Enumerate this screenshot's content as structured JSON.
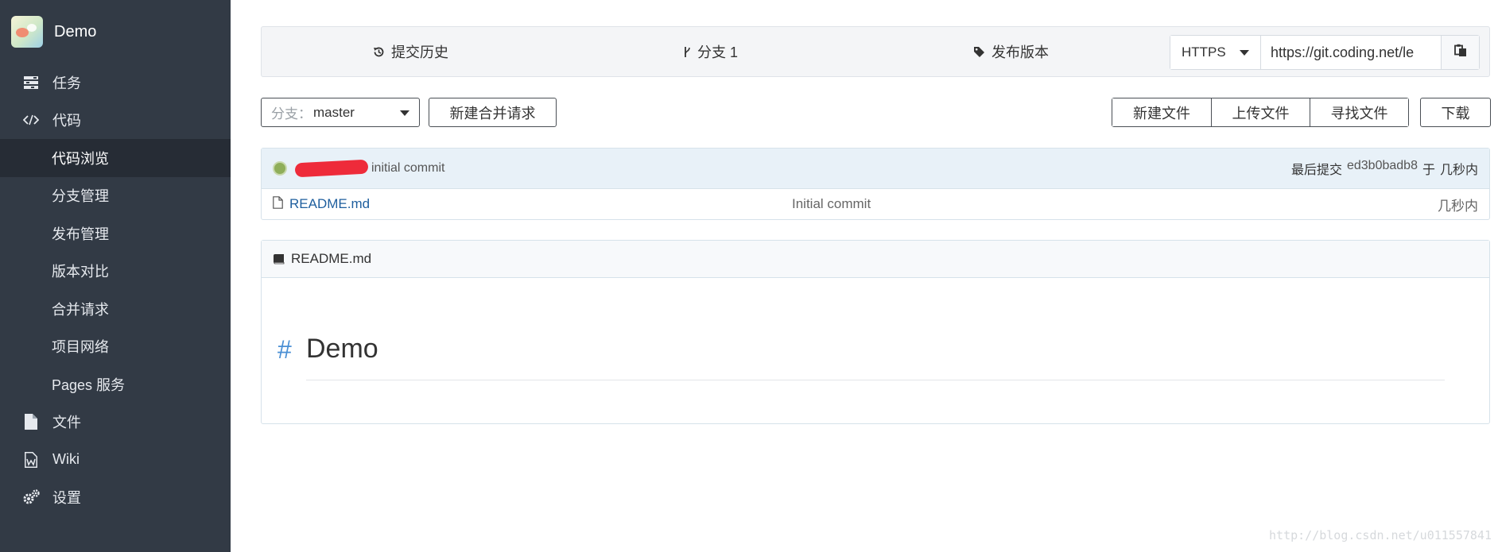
{
  "brand": {
    "name": "Demo"
  },
  "sidebar": {
    "items": [
      {
        "label": "任务",
        "icon": "tasks-icon"
      },
      {
        "label": "代码",
        "icon": "code-icon"
      },
      {
        "label": "代码浏览",
        "active": true
      },
      {
        "label": "分支管理"
      },
      {
        "label": "发布管理"
      },
      {
        "label": "版本对比"
      },
      {
        "label": "合并请求"
      },
      {
        "label": "项目网络"
      },
      {
        "label": "Pages 服务"
      },
      {
        "label": "文件",
        "icon": "file-icon"
      },
      {
        "label": "Wiki",
        "icon": "wiki-icon"
      },
      {
        "label": "设置",
        "icon": "gears-icon"
      }
    ]
  },
  "topbar": {
    "history": "提交历史",
    "branches": "分支 1",
    "releases": "发布版本",
    "protocol": "HTTPS",
    "clone_url": "https://git.coding.net/le"
  },
  "actions": {
    "branch_prefix": "分支：",
    "branch_value": "master",
    "new_merge_request": "新建合并请求",
    "new_file": "新建文件",
    "upload_file": "上传文件",
    "find_file": "寻找文件",
    "download": "下载"
  },
  "commit": {
    "message": "initial commit",
    "last_label": "最后提交",
    "sha": "ed3b0badb8",
    "at_label": "于",
    "time": "几秒内"
  },
  "files": [
    {
      "name": "README.md",
      "message": "Initial commit",
      "time": "几秒内"
    }
  ],
  "readme": {
    "filename": "README.md",
    "hash": "#",
    "title": "Demo"
  },
  "watermark": "http://blog.csdn.net/u011557841",
  "colors": {
    "sidebar": "#323a45",
    "sidebar_active": "#262c35",
    "link": "#1f5f9e",
    "hash": "#4a8fd4"
  }
}
